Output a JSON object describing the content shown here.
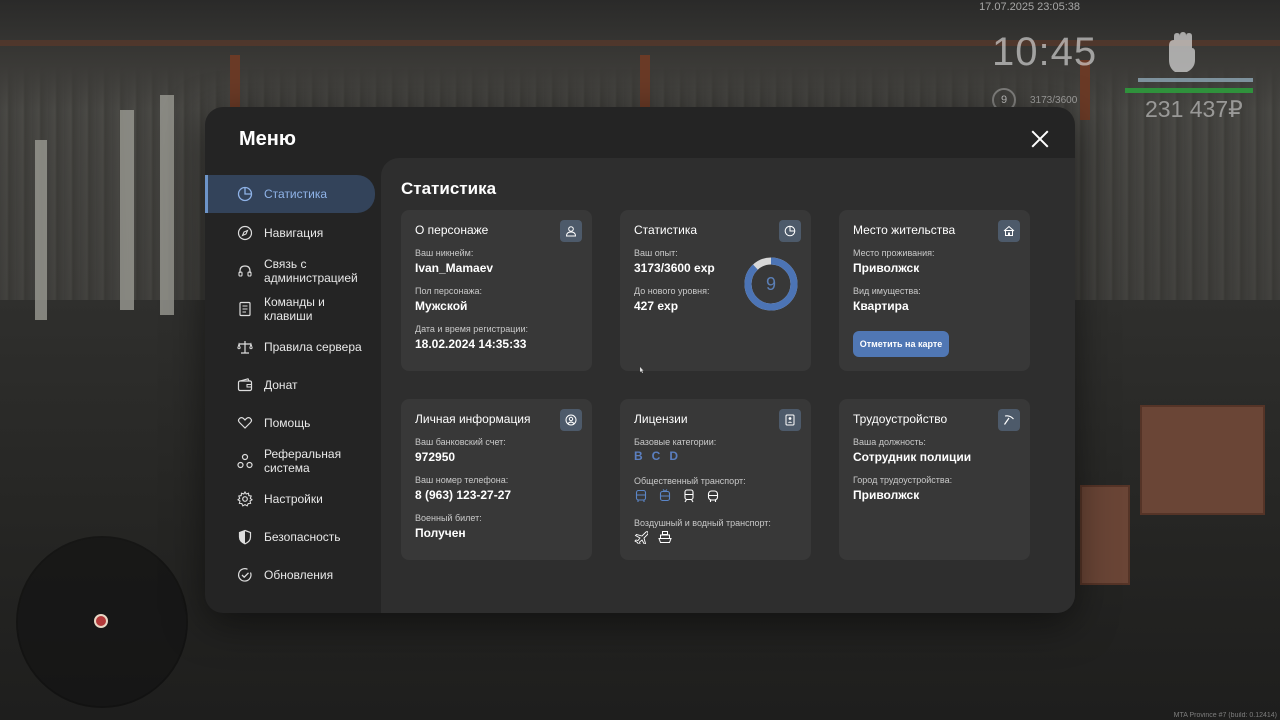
{
  "hud": {
    "datetime": "17.07.2025 23:05:38",
    "clock": "10:45",
    "level": "9",
    "exp": "3173/3600",
    "money": "231 437₽",
    "build": "MTA Province #7 (build: 0.12414)"
  },
  "menu": {
    "title": "Меню",
    "sidebar": [
      {
        "label": "Статистика",
        "icon": "pie-chart-icon",
        "active": true
      },
      {
        "label": "Навигация",
        "icon": "compass-icon"
      },
      {
        "label": "Связь с администрацией",
        "icon": "headset-icon"
      },
      {
        "label": "Команды и клавиши",
        "icon": "document-icon"
      },
      {
        "label": "Правила сервера",
        "icon": "scales-icon"
      },
      {
        "label": "Донат",
        "icon": "wallet-icon"
      },
      {
        "label": "Помощь",
        "icon": "heart-hands-icon"
      },
      {
        "label": "Реферальная система",
        "icon": "referral-icon"
      },
      {
        "label": "Настройки",
        "icon": "gear-icon"
      },
      {
        "label": "Безопасность",
        "icon": "shield-icon"
      },
      {
        "label": "Обновления",
        "icon": "update-check-icon"
      }
    ]
  },
  "content": {
    "title": "Статистика",
    "character": {
      "title": "О персонаже",
      "icon": "user-icon",
      "nickname_label": "Ваш никнейм:",
      "nickname": "Ivan_Mamaev",
      "gender_label": "Пол персонажа:",
      "gender": "Мужской",
      "reg_label": "Дата и время регистрации:",
      "reg": "18.02.2024 14:35:33"
    },
    "stats": {
      "title": "Статистика",
      "icon": "pie-chart-icon",
      "exp_label": "Ваш опыт:",
      "exp": "3173/3600 exp",
      "next_label": "До нового уровня:",
      "next": "427 exp",
      "level": "9",
      "progress": 0.88
    },
    "residence": {
      "title": "Место жительства",
      "icon": "house-icon",
      "place_label": "Место проживания:",
      "place": "Приволжск",
      "property_label": "Вид имущества:",
      "property": "Квартира",
      "button": "Отметить на карте"
    },
    "personal": {
      "title": "Личная информация",
      "icon": "person-circle-icon",
      "bank_label": "Ваш банковский счет:",
      "bank": "972950",
      "phone_label": "Ваш номер телефона:",
      "phone": "8 (963) 123-27-27",
      "military_label": "Военный билет:",
      "military": "Получен"
    },
    "licenses": {
      "title": "Лицензии",
      "icon": "id-card-icon",
      "base_label": "Базовые категории:",
      "categories": [
        "B",
        "C",
        "D"
      ],
      "public_label": "Общественный транспорт:",
      "public_icons": [
        "bus-icon",
        "trolleybus-icon",
        "train-icon",
        "tram-icon"
      ],
      "air_label": "Воздушный и водный транспорт:",
      "air_icons": [
        "plane-icon",
        "ship-icon"
      ]
    },
    "employment": {
      "title": "Трудоустройство",
      "icon": "pickaxe-icon",
      "position_label": "Ваша должность:",
      "position": "Сотрудник полиции",
      "city_label": "Город трудоустройства:",
      "city": "Приволжск"
    }
  }
}
